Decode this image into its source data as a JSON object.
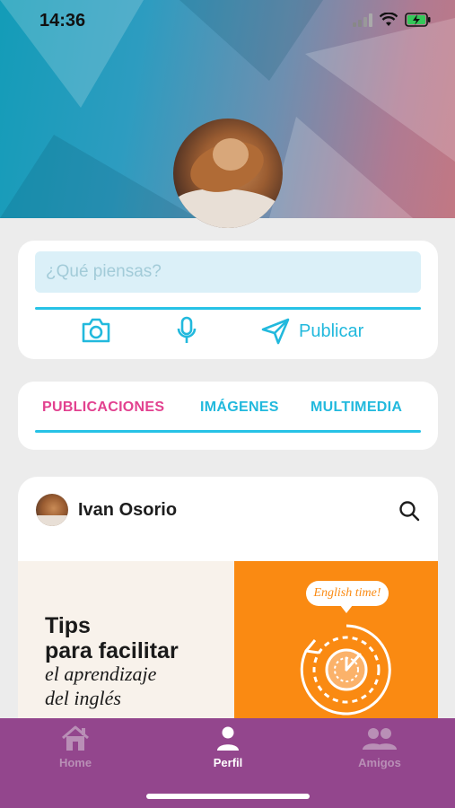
{
  "status_bar": {
    "time": "14:36",
    "icons": [
      "cellular-signal-icon",
      "wifi-icon",
      "battery-charging-icon"
    ]
  },
  "colors": {
    "accent_cyan": "#27c2e6",
    "accent_pink": "#e2418f",
    "nav_background": "#93468d",
    "nav_active": "#ffffff",
    "nav_inactive": "#b98fb6",
    "tips_orange": "#fa8a12"
  },
  "composer": {
    "placeholder": "¿Qué piensas?",
    "value": "",
    "camera_icon": "camera-icon",
    "mic_icon": "microphone-icon",
    "send_icon": "paper-plane-icon",
    "publish_label": "Publicar"
  },
  "tabs": [
    {
      "label": "PUBLICACIONES",
      "active": true
    },
    {
      "label": "IMÁGENES",
      "active": false
    },
    {
      "label": "MULTIMEDIA",
      "active": false
    }
  ],
  "post": {
    "author": "Ivan Osorio",
    "search_icon": "search-icon",
    "image": {
      "title_line1": "Tips",
      "title_line2": "para facilitar",
      "subtitle_line1": "el aprendizaje",
      "subtitle_line2": "del inglés",
      "bubble_text": "English time!"
    }
  },
  "bottom_nav": [
    {
      "label": "Home",
      "icon": "home-icon",
      "active": false
    },
    {
      "label": "Perfil",
      "icon": "user-icon",
      "active": true
    },
    {
      "label": "Amigos",
      "icon": "friends-icon",
      "active": false
    }
  ]
}
